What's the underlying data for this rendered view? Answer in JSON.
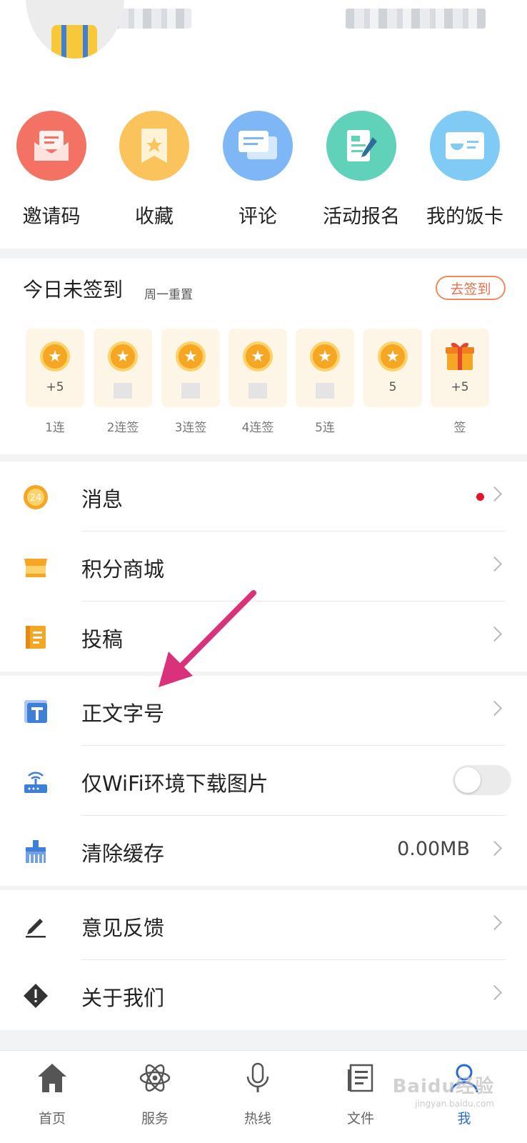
{
  "quick_actions": [
    {
      "label": "邀请码",
      "color": "#f37264",
      "icon": "envelope-icon"
    },
    {
      "label": "收藏",
      "color": "#fbc35c",
      "icon": "bookmark-star-icon"
    },
    {
      "label": "评论",
      "color": "#7fb6f6",
      "icon": "chat-bubbles-icon"
    },
    {
      "label": "活动报名",
      "color": "#5fd2b9",
      "icon": "signup-form-icon"
    },
    {
      "label": "我的饭卡",
      "color": "#7fcbf6",
      "icon": "meal-card-icon"
    }
  ],
  "checkin": {
    "title": "今日未签到",
    "subtitle": "周一重置",
    "button": "去签到",
    "days": [
      {
        "points": "+5",
        "label": "1连"
      },
      {
        "points": "",
        "label": "2连签"
      },
      {
        "points": "",
        "label": "3连签"
      },
      {
        "points": "",
        "label": "4连签"
      },
      {
        "points": "",
        "label": "5连"
      },
      {
        "points": "5",
        "label": ""
      },
      {
        "points": "+5",
        "label": "签"
      }
    ]
  },
  "menu1": [
    {
      "label": "消息",
      "icon": "clock-24-icon",
      "badge": true
    },
    {
      "label": "积分商城",
      "icon": "shop-icon"
    },
    {
      "label": "投稿",
      "icon": "notebook-icon"
    }
  ],
  "menu2": [
    {
      "label": "正文字号",
      "icon": "text-size-icon"
    },
    {
      "label": "仅WiFi环境下载图片",
      "icon": "router-icon",
      "toggle": false
    },
    {
      "label": "清除缓存",
      "icon": "broom-icon",
      "value": "0.00MB"
    }
  ],
  "menu3": [
    {
      "label": "意见反馈",
      "icon": "pencil-icon"
    },
    {
      "label": "关于我们",
      "icon": "info-diamond-icon"
    }
  ],
  "tabs": [
    {
      "label": "首页",
      "icon": "home-icon"
    },
    {
      "label": "服务",
      "icon": "atom-icon"
    },
    {
      "label": "热线",
      "icon": "microphone-icon"
    },
    {
      "label": "文件",
      "icon": "document-icon"
    },
    {
      "label": "我",
      "icon": "user-icon",
      "active": true
    }
  ],
  "watermark": {
    "main": "Baidu经验",
    "sub": "jingyan.baidu.com"
  },
  "colors": {
    "accent_orange": "#e8704a",
    "active_blue": "#2a6ad8",
    "badge_red": "#e8112d",
    "coin": "#f5a623"
  }
}
